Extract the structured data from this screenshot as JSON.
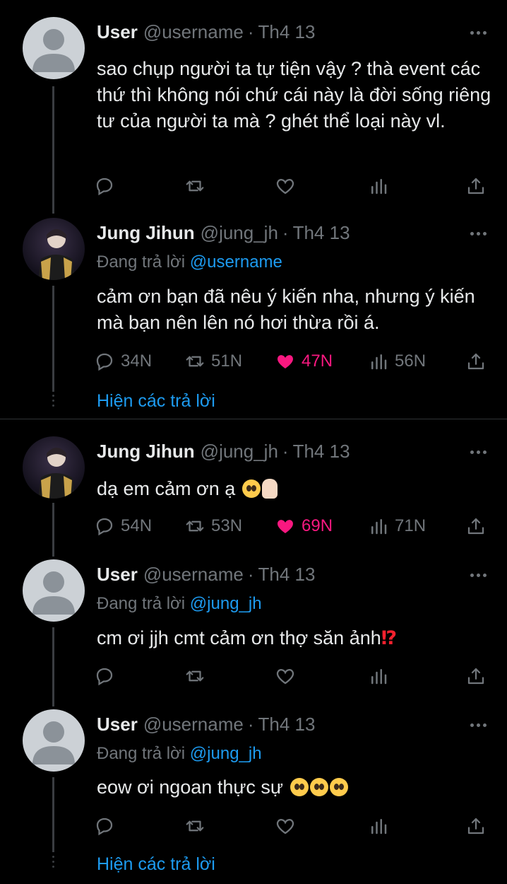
{
  "tweets": [
    {
      "name": "User",
      "handle": "@username",
      "sep": "·",
      "date": "Th4 13",
      "text": "sao chụp người ta tự tiện vậy ? thà event các thứ thì không nói chứ cái này là đời sống riêng tư của người ta mà ? ghét thể loại này vl.",
      "replies": "",
      "retweets": "",
      "likes": "",
      "views": ""
    },
    {
      "name": "Jung Jihun",
      "handle": "@jung_jh",
      "sep": "·",
      "date": "Th4 13",
      "replying_prefix": "Đang trả lời",
      "replying_to": "@username",
      "text": "cảm ơn bạn đã nêu ý kiến nha, nhưng ý kiến mà bạn nên lên nó hơi thừa rồi á.",
      "replies": "34N",
      "retweets": "51N",
      "likes": "47N",
      "views": "56N"
    },
    {
      "name": "Jung Jihun",
      "handle": "@jung_jh",
      "sep": "·",
      "date": "Th4 13",
      "text": "dạ em cảm ơn ạ",
      "replies": "54N",
      "retweets": "53N",
      "likes": "69N",
      "views": "71N"
    },
    {
      "name": "User",
      "handle": "@username",
      "sep": "·",
      "date": "Th4 13",
      "replying_prefix": "Đang trả lời",
      "replying_to": "@jung_jh",
      "text": "cm ơi jjh cmt cảm ơn thợ săn ảnh",
      "replies": "",
      "retweets": "",
      "likes": "",
      "views": ""
    },
    {
      "name": "User",
      "handle": "@username",
      "sep": "·",
      "date": "Th4 13",
      "replying_prefix": "Đang trả lời",
      "replying_to": "@jung_jh",
      "text": "eow ơi ngoan thực sự",
      "replies": "",
      "retweets": "",
      "likes": "",
      "views": ""
    }
  ],
  "show_replies_label": "Hiện các trả lời",
  "colors": {
    "background": "#000000",
    "accent": "#1d9bf0",
    "like": "#f91880",
    "muted": "#71767b"
  }
}
